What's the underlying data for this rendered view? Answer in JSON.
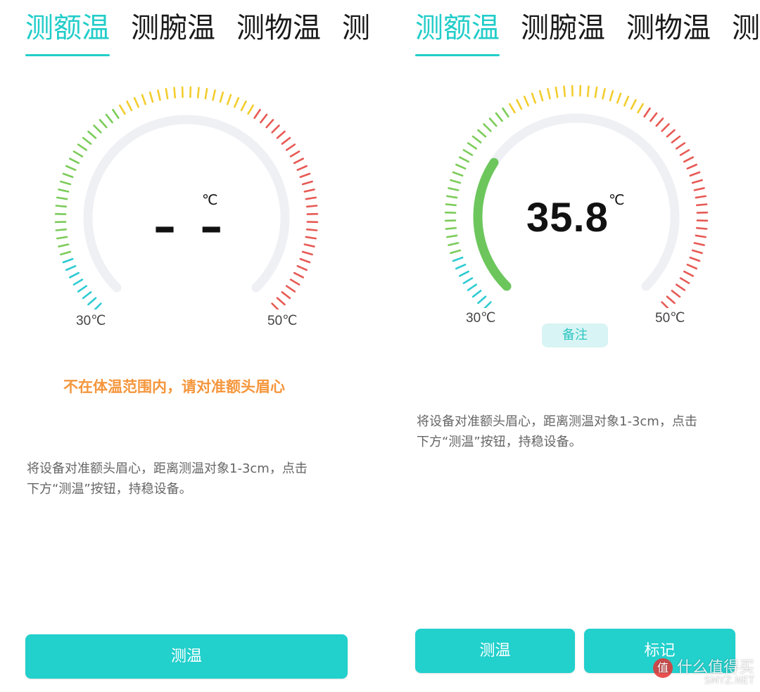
{
  "screens": [
    {
      "tabs": [
        {
          "label": "测额温",
          "active": true
        },
        {
          "label": "测腕温",
          "active": false
        },
        {
          "label": "测物温",
          "active": false
        },
        {
          "label": "测",
          "active": false
        }
      ],
      "gauge": {
        "unit": "℃",
        "reading": "– –",
        "min_label": "30℃",
        "max_label": "50℃",
        "min_value": 30,
        "max_value": 50,
        "value": null,
        "progress_color": "#6cc65c",
        "track_color": "#eef0f4"
      },
      "warning_text": "不在体温范围内，请对准额头眉心",
      "hint_text_line1": "将设备对准额头眉心，距离测温对象1-3cm，点击",
      "hint_text_line2": "下方“测温”按钮，持稳设备。",
      "buttons": {
        "measure": "测温"
      }
    },
    {
      "tabs": [
        {
          "label": "测额温",
          "active": true
        },
        {
          "label": "测腕温",
          "active": false
        },
        {
          "label": "测物温",
          "active": false
        },
        {
          "label": "测",
          "active": false
        }
      ],
      "gauge": {
        "unit": "℃",
        "reading": "35.8",
        "min_label": "30℃",
        "max_label": "50℃",
        "min_value": 30,
        "max_value": 50,
        "value": 35.8,
        "progress_color": "#6cc65c",
        "track_color": "#eef0f4"
      },
      "note_chip": "备注",
      "hint_text_line1": "将设备对准额头眉心，距离测温对象1-3cm，点击",
      "hint_text_line2": "下方“测温”按钮，持稳设备。",
      "buttons": {
        "measure": "测温",
        "mark": "标记"
      }
    }
  ],
  "colors": {
    "accent": "#22cdc9",
    "warning": "#f5963c",
    "tick_cyan": "#2ecbd2",
    "tick_green": "#7ccc5a",
    "tick_yellow": "#f3cd2e",
    "tick_red": "#e75a55"
  },
  "watermark": {
    "logo": "值",
    "text": "什么值得买",
    "sub": "SMYZ.NET"
  }
}
